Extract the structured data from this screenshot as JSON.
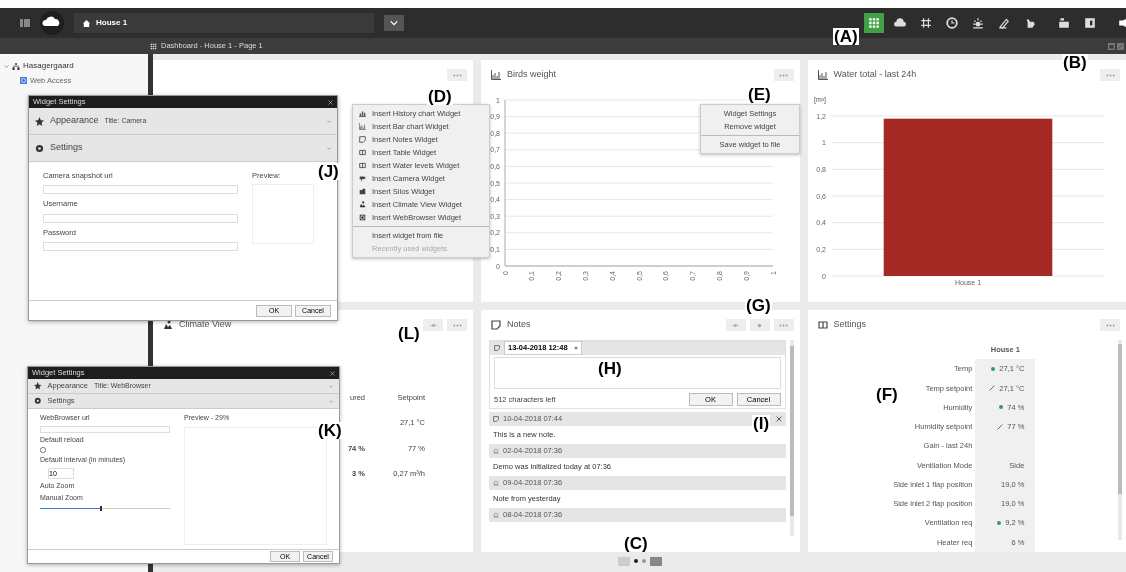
{
  "top_bar": {
    "house": "House 1",
    "toolbar": [
      {
        "selected": true
      },
      {
        "selected": false
      },
      {
        "selected": false
      },
      {
        "selected": false
      },
      {
        "selected": false
      },
      {
        "selected": false
      },
      {
        "selected": false
      },
      {
        "selected": false
      },
      {
        "selected": false
      },
      {
        "selected": false
      }
    ]
  },
  "breadcrumb": "Dashboard - House 1 - Page 1",
  "sidebar": {
    "items": [
      {
        "label": "Hasagergaard",
        "expanded": true,
        "children": [
          {
            "label": "Web Access"
          }
        ]
      }
    ]
  },
  "widgets": [
    {
      "kind": "empty"
    },
    {
      "kind": "line_chart",
      "title": "Birds weight",
      "chart_data": {
        "type": "line",
        "grid": true,
        "xlim": [
          0,
          1
        ],
        "ylim": [
          0,
          1
        ],
        "xticks": [
          {
            "value": 0,
            "label": "0"
          },
          {
            "value": 0.1,
            "label": "0,1"
          },
          {
            "value": 0.2,
            "label": "0,2"
          },
          {
            "value": 0.3,
            "label": "0,3"
          },
          {
            "value": 0.4,
            "label": "0,4"
          },
          {
            "value": 0.5,
            "label": "0,5"
          },
          {
            "value": 0.6,
            "label": "0,6"
          },
          {
            "value": 0.7,
            "label": "0,7"
          },
          {
            "value": 0.8,
            "label": "0,8"
          },
          {
            "value": 0.9,
            "label": "0,9"
          },
          {
            "value": 1,
            "label": "1"
          }
        ],
        "yticks": [
          {
            "value": 0,
            "label": "0"
          },
          {
            "value": 0.1,
            "label": "0,1"
          },
          {
            "value": 0.2,
            "label": "0,2"
          },
          {
            "value": 0.3,
            "label": "0,3"
          },
          {
            "value": 0.4,
            "label": "0,4"
          },
          {
            "value": 0.5,
            "label": "0,5"
          },
          {
            "value": 0.6,
            "label": "0,6"
          },
          {
            "value": 0.7,
            "label": "0,7"
          },
          {
            "value": 0.8,
            "label": "0,8"
          },
          {
            "value": 0.9,
            "label": "0,9"
          },
          {
            "value": 1,
            "label": "1"
          }
        ]
      }
    },
    {
      "kind": "bar_chart",
      "title": "Water total - last 24h",
      "chart_data": {
        "type": "bar",
        "grid": true,
        "ylabel": "[m³]",
        "categories": [
          "House 1"
        ],
        "series": [
          {
            "color": "#a52a26",
            "values": [
              1.18
            ]
          }
        ],
        "ylim": [
          0,
          1.2
        ],
        "yticks": [
          {
            "value": 0,
            "label": "0"
          },
          {
            "value": 0.2,
            "label": "0,2"
          },
          {
            "value": 0.4,
            "label": "0,4"
          },
          {
            "value": 0.6,
            "label": "0,6"
          },
          {
            "value": 0.8,
            "label": "0,8"
          },
          {
            "value": 1,
            "label": "1"
          },
          {
            "value": 1.2,
            "label": "1,2"
          }
        ]
      }
    },
    {
      "kind": "climate",
      "title": "Climate View",
      "columns": [
        "ured",
        "Setpoint"
      ],
      "rows": [
        {
          "setpoint": "27,1 °C"
        },
        {
          "measured": "74 %",
          "setpoint": "77 %"
        },
        {
          "measured": "3 %",
          "setpoint": "0,27 m³/h"
        }
      ]
    },
    {
      "kind": "notes",
      "title": "Notes",
      "editor": {
        "date": "13-04-2018 12:48",
        "chars_left": "512 characters left",
        "buttons": [
          "OK",
          "Cancel"
        ]
      },
      "notes": [
        {
          "kind": "note",
          "date": "10-04-2018 07:44",
          "text": "This is a new note.",
          "removable": true
        },
        {
          "kind": "alarm",
          "date": "02-04-2018 07:36",
          "text": "Demo was initialized today at 07:36",
          "removable": false
        },
        {
          "kind": "alarm",
          "date": "09-04-2018 07:36",
          "text": "Note from yesterday",
          "removable": false
        },
        {
          "kind": "alarm",
          "date": "08-04-2018 07:36",
          "removable": false
        }
      ]
    },
    {
      "kind": "table",
      "title": "Settings",
      "column": "House 1",
      "rows": [
        {
          "label": "Temp",
          "value": "27,1 °C",
          "kind": "dot"
        },
        {
          "label": "Temp setpoint",
          "value": "27,1 °C",
          "kind": "edit"
        },
        {
          "label": "Humidity",
          "value": "74 %",
          "kind": "dot"
        },
        {
          "label": "Humidity setpoint",
          "value": "77 %",
          "kind": "edit"
        },
        {
          "label": "Gain - last 24h"
        },
        {
          "label": "Ventilation Mode",
          "value": "Side"
        },
        {
          "label": "Side inlet 1 flap position",
          "value": "19,0 %"
        },
        {
          "label": "Side inlet 2 flap position",
          "value": "19,0 %"
        },
        {
          "label": "Ventilation req",
          "value": "9,2 %",
          "kind": "dot"
        },
        {
          "label": "Heater req",
          "value": "6 %"
        }
      ]
    }
  ],
  "insert_menu": {
    "items": [
      {
        "label": "Insert History chart Widget"
      },
      {
        "label": "Insert Bar chart Widget"
      },
      {
        "label": "Insert Notes Widget"
      },
      {
        "label": "Insert Table Widget"
      },
      {
        "label": "Insert Water levels Widget"
      },
      {
        "label": "Insert Camera Widget"
      },
      {
        "label": "Insert Silos Widget"
      },
      {
        "label": "Insert Climate View Widget"
      },
      {
        "label": "Insert WebBrowser Widget"
      }
    ],
    "footer": [
      {
        "label": "Insert widget from file",
        "disabled": false
      },
      {
        "label": "Recently used widgets",
        "disabled": true
      }
    ]
  },
  "widget_menu": {
    "items": [
      "Widget Settings",
      "Remove widget",
      "Save widget to file"
    ]
  },
  "dialogs": [
    {
      "title": "Widget Settings",
      "appearance": "Appearance",
      "appearance_value": "Title: Camera",
      "settings": "Settings",
      "fields": [
        {
          "kind": "text",
          "label": "Camera snapshot url"
        },
        {
          "kind": "text",
          "label": "Username"
        },
        {
          "kind": "text",
          "label": "Password"
        }
      ],
      "preview": "Preview:",
      "buttons": [
        "OK",
        "Cancel"
      ]
    },
    {
      "title": "Widget Settings",
      "appearance": "Appearance",
      "appearance_value": "Title: WebBrowser",
      "settings": "Settings",
      "fields": [
        {
          "kind": "text",
          "label": "WebBrowser url"
        },
        {
          "kind": "checkbox",
          "label": "Default reload",
          "checked": false
        },
        {
          "kind": "spin",
          "label": "Default interval (in minutes)",
          "value": "10"
        },
        {
          "kind": "label",
          "label": "Auto Zoom"
        },
        {
          "kind": "slider",
          "label": "Manual Zoom",
          "level": 0.47
        }
      ],
      "preview": "Preview - 29%",
      "buttons": [
        "OK",
        "Cancel"
      ]
    }
  ],
  "pager": {
    "pages": [
      {
        "selected": true
      },
      {
        "selected": false
      }
    ]
  },
  "callouts": [
    "(A)",
    "(B)",
    "(C)",
    "(D)",
    "(E)",
    "(F)",
    "(G)",
    "(H)",
    "(I)",
    "(J)",
    "(K)",
    "(L)"
  ]
}
